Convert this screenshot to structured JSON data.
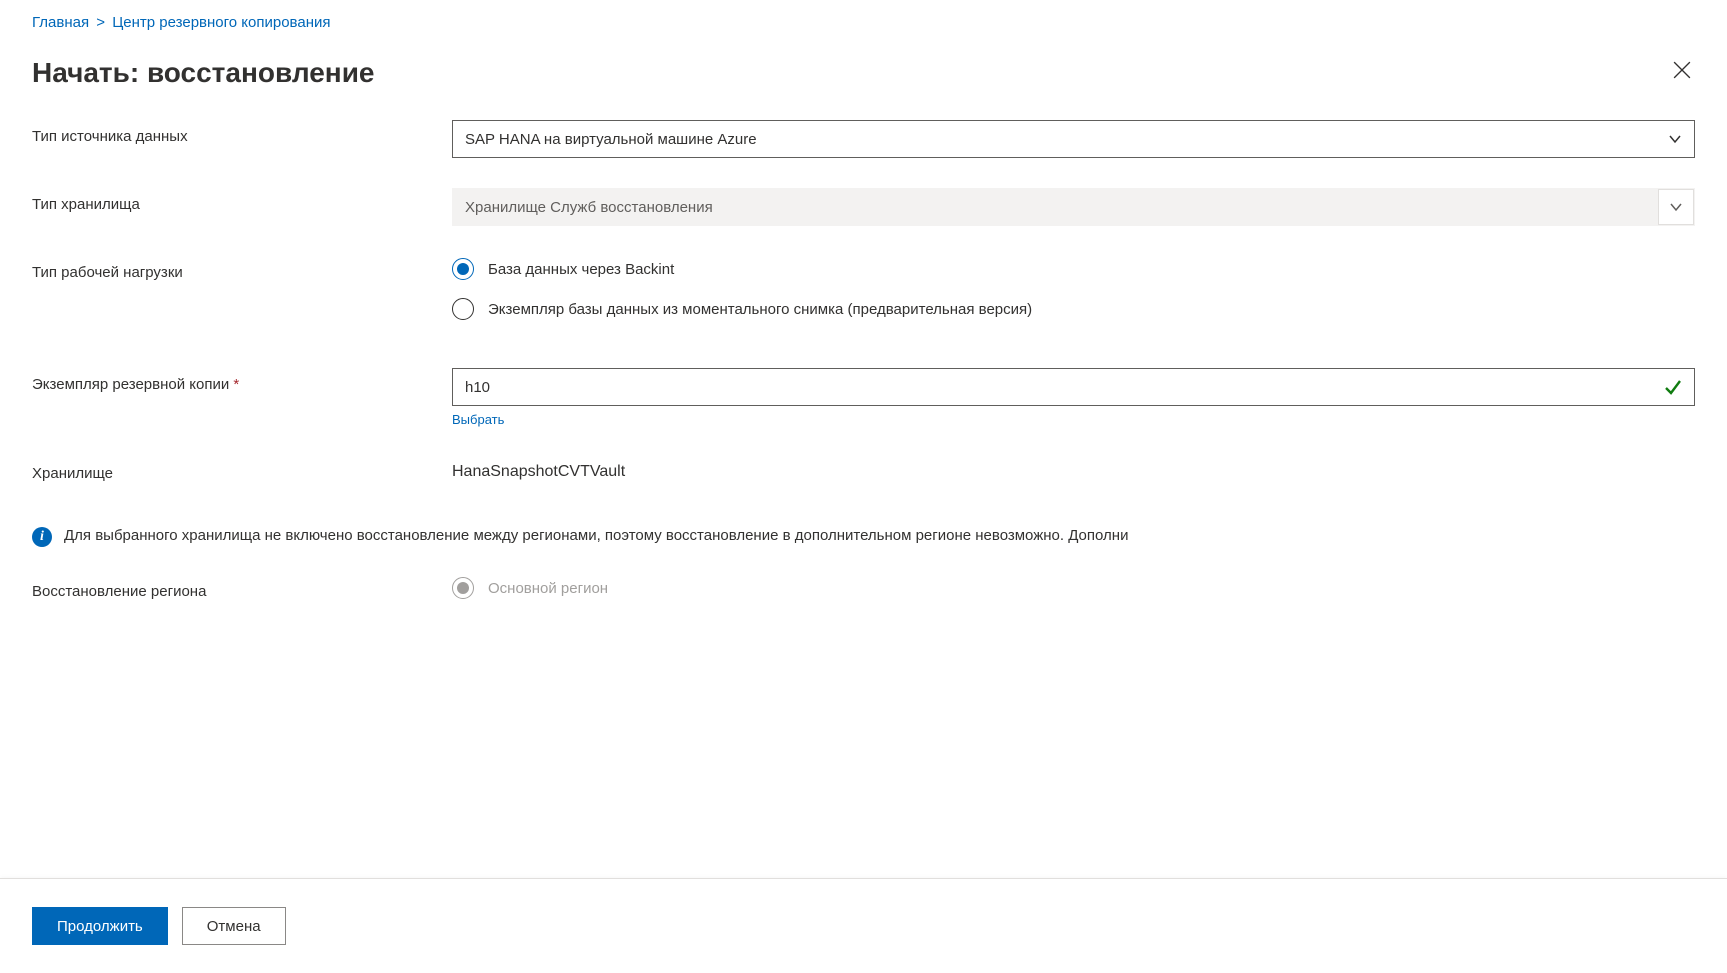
{
  "breadcrumb": {
    "home": "Главная",
    "backup_center": "Центр резервного копирования"
  },
  "header": {
    "title": "Начать: восстановление"
  },
  "labels": {
    "datasource_type": "Тип источника данных",
    "vault_type": "Тип хранилища",
    "workload_type": "Тип рабочей нагрузки",
    "backup_instance": "Экземпляр резервной копии",
    "vault": "Хранилище",
    "region_restore": "Восстановление региона"
  },
  "fields": {
    "datasource_type_value": "SAP HANA на виртуальной машине Azure",
    "vault_type_value": "Хранилище Служб восстановления",
    "workload_options": {
      "backint": "База данных через Backint",
      "snapshot": "Экземпляр базы данных из моментального снимка (предварительная версия)"
    },
    "backup_instance_value": "h10",
    "select_link": "Выбрать",
    "vault_value": "HanaSnapshotCVTVault",
    "region_options": {
      "primary": "Основной регион"
    }
  },
  "info_message": "Для выбранного хранилища не включено восстановление между регионами, поэтому восстановление в дополнительном регионе невозможно. Дополни",
  "footer": {
    "continue": "Продолжить",
    "cancel": "Отмена"
  }
}
